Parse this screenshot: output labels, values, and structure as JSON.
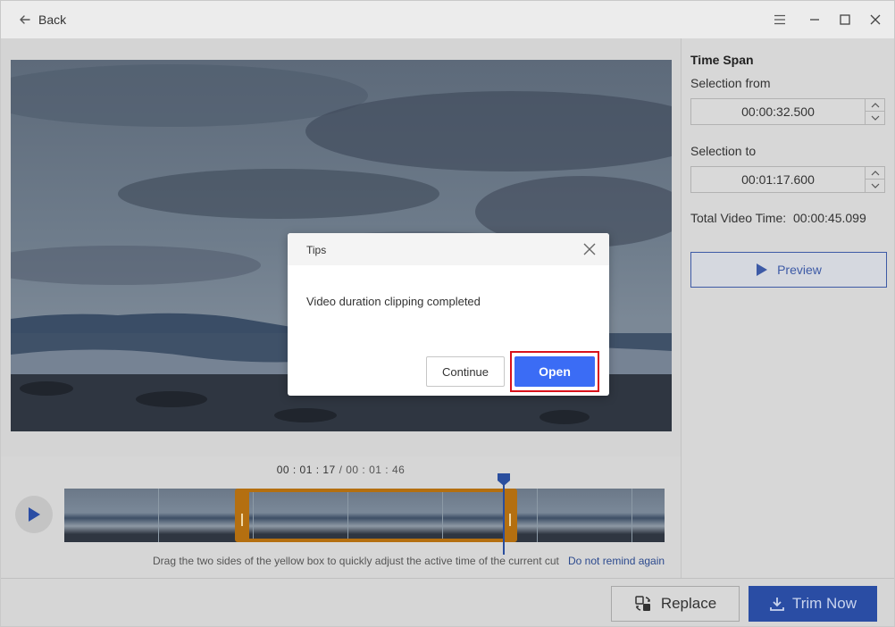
{
  "titlebar": {
    "back_label": "Back",
    "icons": [
      "arrow-left-icon",
      "menu-icon",
      "minimize-icon",
      "maximize-icon",
      "close-icon"
    ]
  },
  "timeline": {
    "current_time": "00 : 01 : 17",
    "separator": " / ",
    "total_time": "00 : 01 : 46",
    "hint": "Drag the two sides of the yellow box to quickly adjust the active time of the current cut",
    "dont_remind": "Do not remind again"
  },
  "right_panel": {
    "title": "Time Span",
    "from_label": "Selection from",
    "from_value": "00:00:32.500",
    "to_label": "Selection to",
    "to_value": "00:01:17.600",
    "total_label": "Total Video Time:",
    "total_value": "00:00:45.099",
    "preview_label": "Preview"
  },
  "bottom": {
    "replace_label": "Replace",
    "trim_label": "Trim Now"
  },
  "dialog": {
    "title": "Tips",
    "message": "Video duration clipping completed",
    "continue_label": "Continue",
    "open_label": "Open"
  },
  "colors": {
    "accent": "#3b6cf5",
    "dimmed_accent": "#2a4da4",
    "selection_box": "#b46f10",
    "highlight_frame": "#d8121b"
  }
}
